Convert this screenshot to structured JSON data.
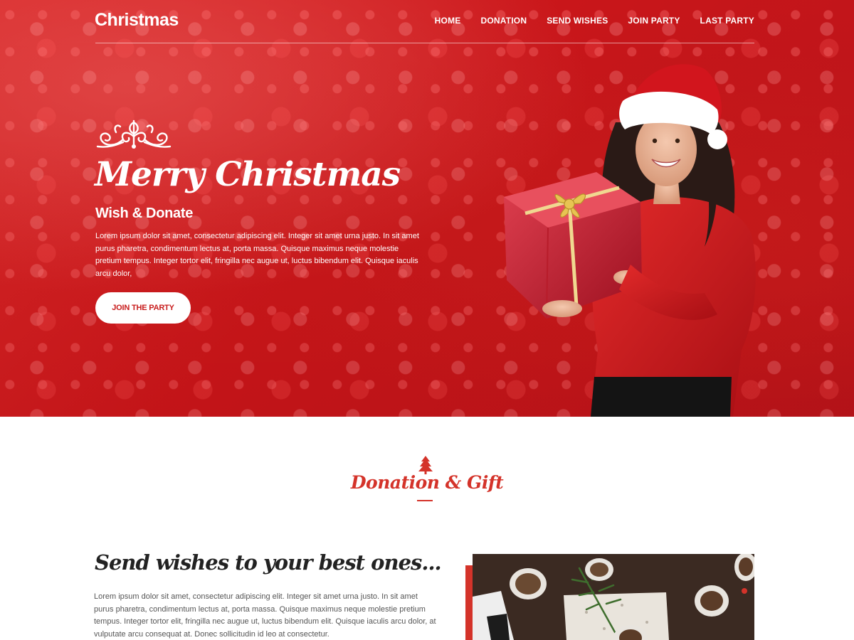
{
  "header": {
    "logo": "Christmas",
    "nav": [
      {
        "label": "HOME"
      },
      {
        "label": "DONATION"
      },
      {
        "label": "SEND WISHES"
      },
      {
        "label": "JOIN PARTY"
      },
      {
        "label": "LAST PARTY"
      }
    ]
  },
  "hero": {
    "title": "Merry Christmas",
    "subtitle": "Wish & Donate",
    "text": "Lorem ipsum dolor sit amet, consectetur adipiscing elit. Integer sit amet urna justo. In sit amet purus pharetra, condimentum lectus at, porta massa. Quisque maximus neque molestie pretium tempus. Integer tortor elit, fringilla nec augue ut, luctus bibendum elit. Quisque iaculis arcu dolor,",
    "button": "JOIN THE PARTY"
  },
  "section": {
    "heading": "Donation & Gift",
    "wish_title": "Send wishes to your best ones...",
    "wish_text": "Lorem ipsum dolor sit amet, consectetur adipiscing elit. Integer sit amet urna justo. In sit amet purus pharetra, condimentum lectus at, porta massa. Quisque maximus neque molestie pretium tempus. Integer tortor elit, fringilla nec augue ut, luctus bibendum elit. Quisque iaculis arcu dolor, at vulputate arcu consequat at. Donec sollicitudin id leo at consectetur."
  },
  "colors": {
    "hero_red": "#c9161a",
    "accent_red": "#d4332a",
    "white": "#ffffff",
    "heading_dark": "#222222"
  },
  "icons": [
    "ornament-flourish-icon",
    "christmas-tree-icon"
  ]
}
